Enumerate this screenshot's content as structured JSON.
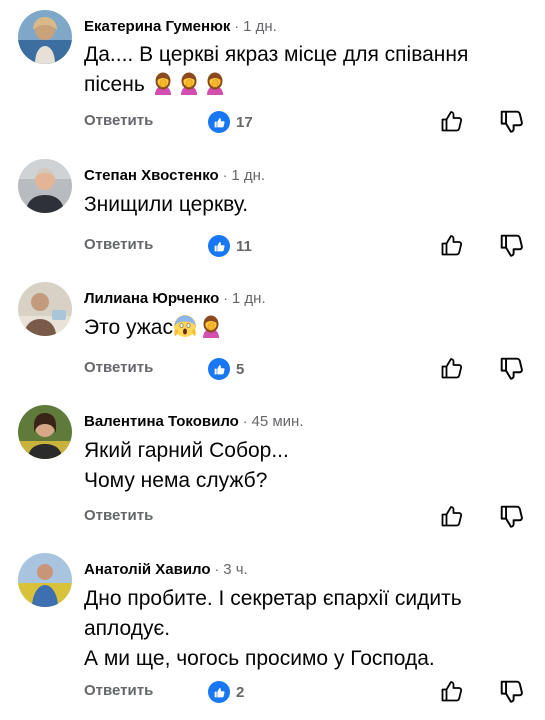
{
  "comments": [
    {
      "author": "Екатерина Гуменюк",
      "time": "1 дн.",
      "lines": [
        "Да.... В церкві якраз місце для співання",
        "пісень"
      ],
      "emojis": [
        "woman-facepalming",
        "woman-facepalming",
        "woman-facepalming"
      ],
      "reply_label": "Ответить",
      "like_count": "17"
    },
    {
      "author": "Степан Хвостенко",
      "time": "1 дн.",
      "lines": [
        "Знищили церкву."
      ],
      "reply_label": "Ответить",
      "like_count": "11"
    },
    {
      "author": "Лилиана Юрченко",
      "time": "1 дн.",
      "lines": [
        "Это ужас"
      ],
      "emojis": [
        "face-screaming-in-fear",
        "woman-facepalming"
      ],
      "reply_label": "Ответить",
      "like_count": "5"
    },
    {
      "author": "Валентина Токовило",
      "time": "45 мин.",
      "lines": [
        "Який гарний Собор...",
        "Чому нема служб?"
      ],
      "reply_label": "Ответить"
    },
    {
      "author": "Анатолій Хавило",
      "time": "3 ч.",
      "lines": [
        "Дно пробите. І секретар єпархії сидить",
        "аплодує.",
        "А ми ще, чогось просимо у Господа."
      ],
      "reply_label": "Ответить",
      "like_count": "2"
    }
  ],
  "colors": {
    "like_blue": "#1877f2",
    "meta_gray": "#65676b",
    "text": "#050505"
  },
  "icons": {
    "like_badge": "thumbs-up-icon",
    "like_action": "thumbs-up-outline-icon",
    "dislike_action": "thumbs-down-outline-icon"
  }
}
